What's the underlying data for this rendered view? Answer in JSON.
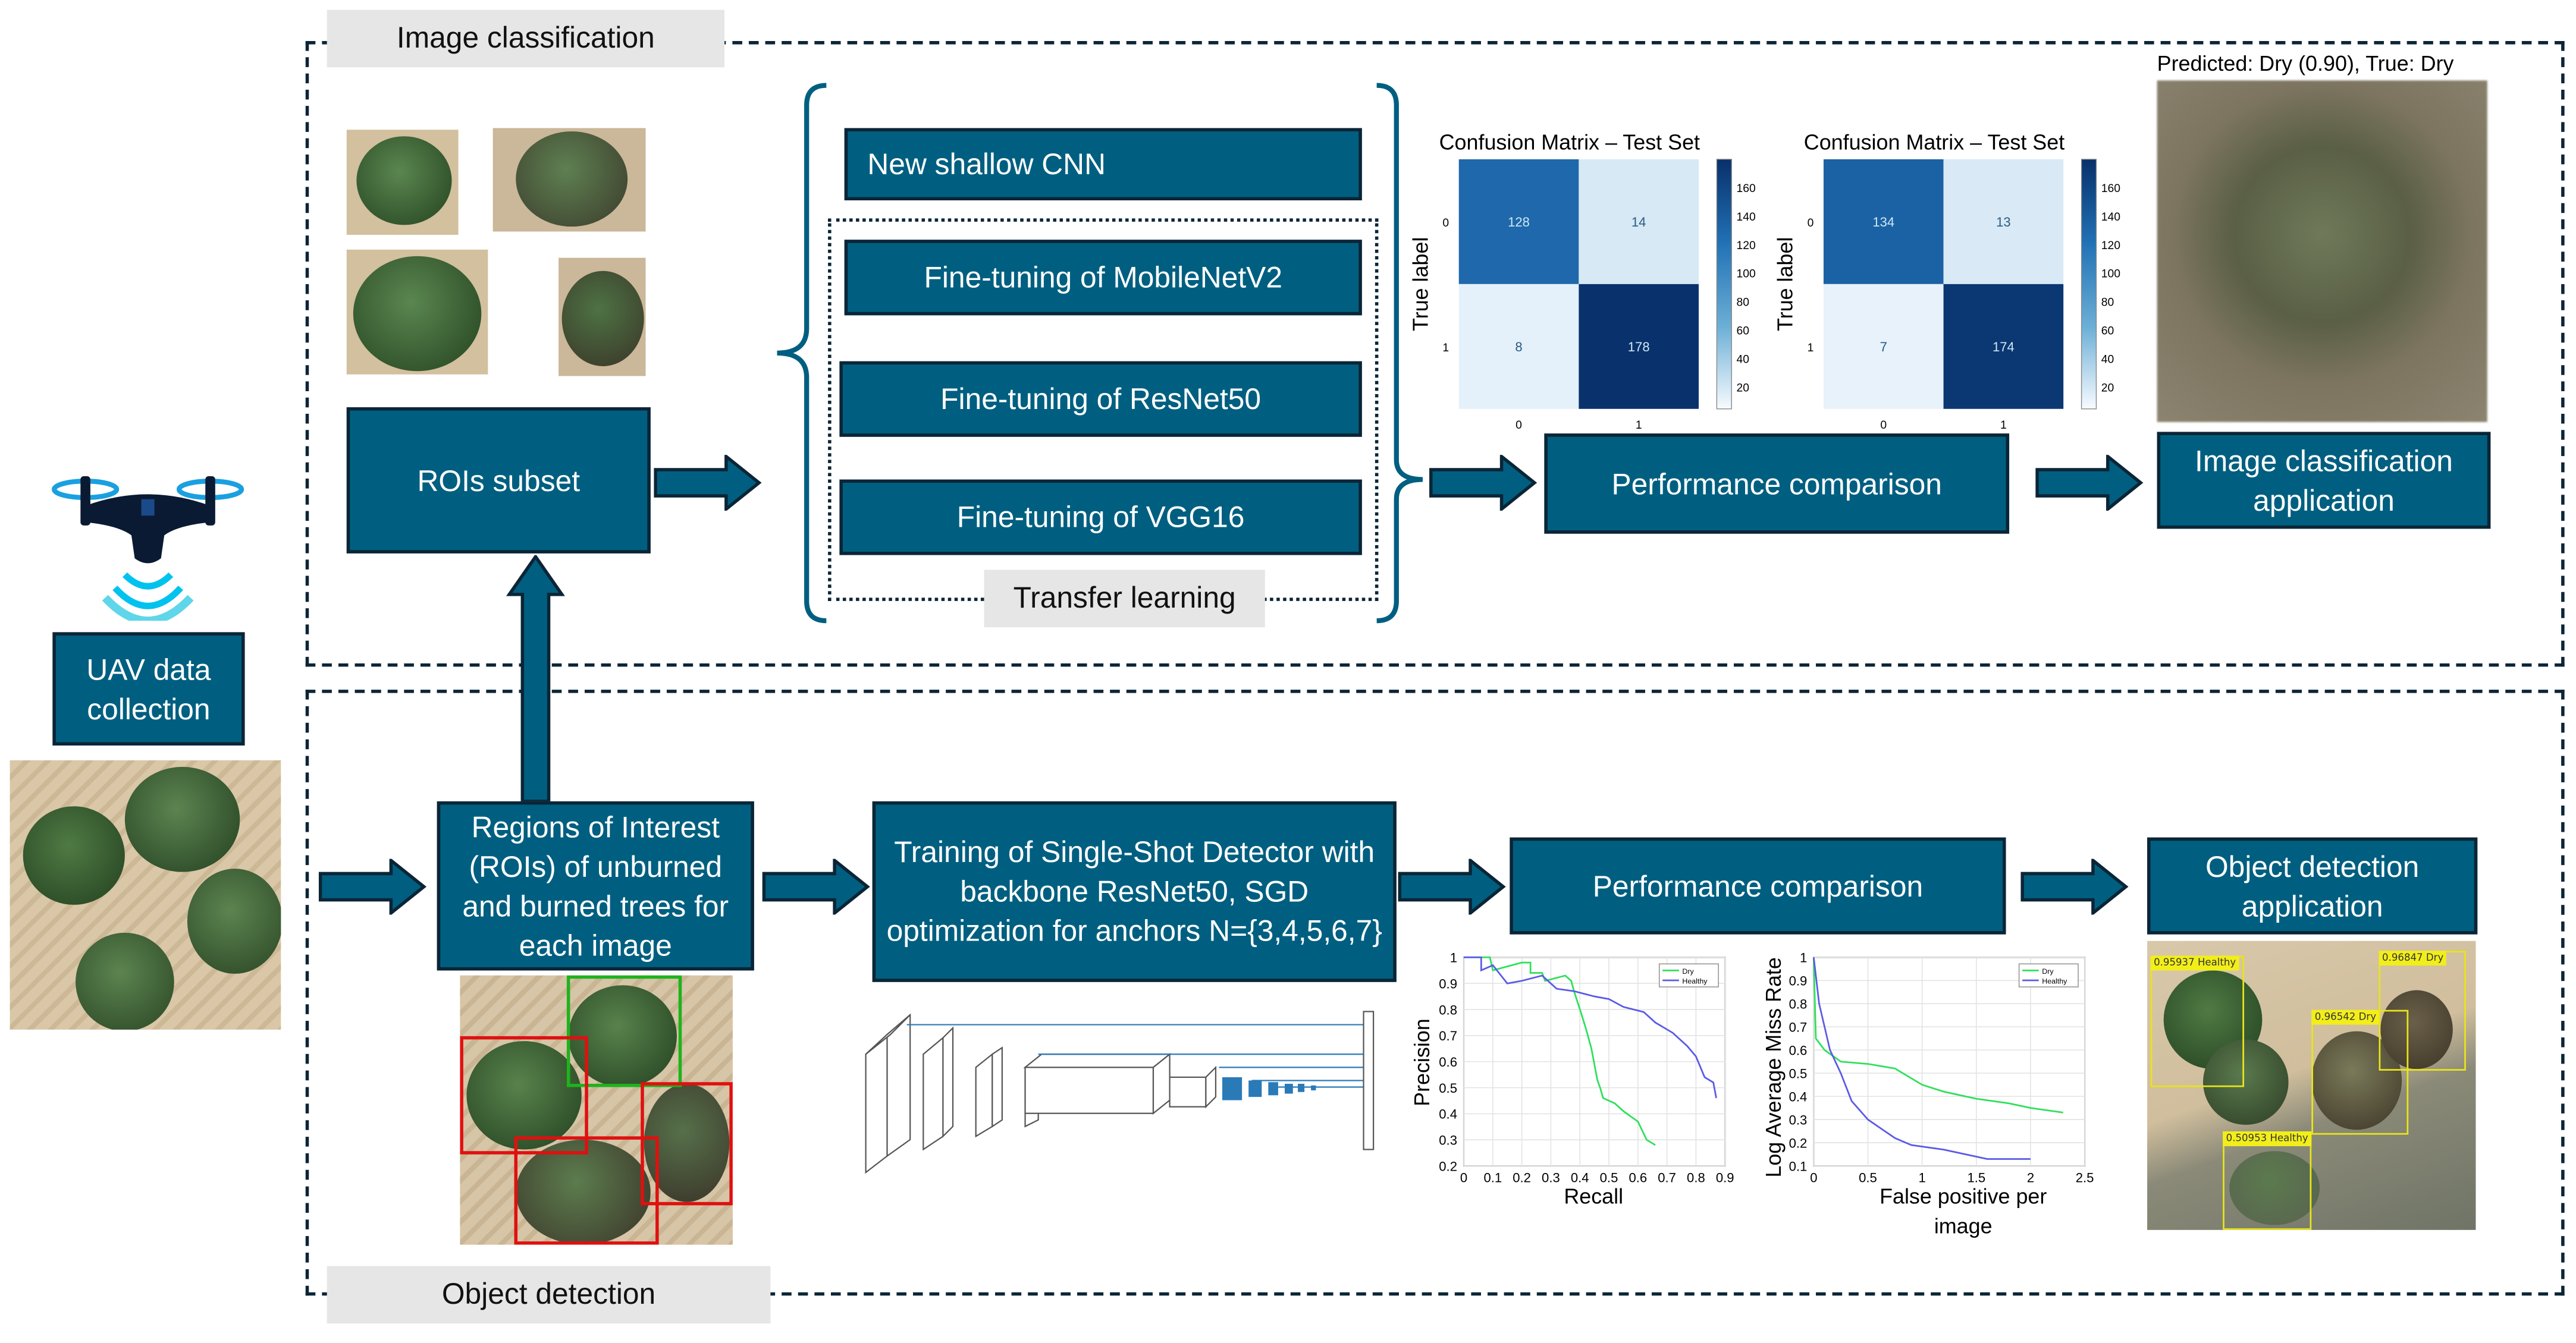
{
  "sections": {
    "classification_label": "Image classification",
    "detection_label": "Object detection"
  },
  "uav": {
    "label": "UAV data collection",
    "icon": "drone-icon"
  },
  "classification": {
    "rois_subset": "ROIs subset",
    "models": {
      "shallow_cnn": "New shallow CNN",
      "mobilenet": "Fine-tuning of MobileNetV2",
      "resnet": "Fine-tuning of ResNet50",
      "vgg": "Fine-tuning of VGG16"
    },
    "transfer_learning": "Transfer learning",
    "performance": "Performance comparison",
    "prediction_caption": "Predicted: Dry (0.90), True: Dry",
    "application": "Image classification application"
  },
  "detection": {
    "rois": "Regions of Interest (ROIs) of unburned and burned trees for each image",
    "training": "Training of Single-Shot Detector with backbone ResNet50, SGD optimization for anchors N={3,4,5,6,7}",
    "performance": "Performance comparison",
    "application": "Object detection application",
    "detections": [
      {
        "score": "0.95937",
        "label": "Healthy"
      },
      {
        "score": "0.96847",
        "label": "Dry"
      },
      {
        "score": "0.96542",
        "label": "Dry"
      },
      {
        "score": "0.50953",
        "label": "Healthy"
      }
    ]
  },
  "colors": {
    "box_fill": "#005f80",
    "box_border": "#0b2536",
    "dry": "#2ee05a",
    "healthy": "#5a5ae6",
    "detection_box": "#f2ee1a",
    "roi_healthy": "#1db31d",
    "roi_burned": "#e01010"
  },
  "chart_data": [
    {
      "type": "heatmap",
      "title": "Confusion Matrix – Test Set",
      "ylabel": "True label",
      "x_ticks": [
        "0",
        "1"
      ],
      "y_ticks": [
        "0",
        "1"
      ],
      "values": [
        [
          128,
          14
        ],
        [
          8,
          178
        ]
      ],
      "colorbar_ticks": [
        "160",
        "140",
        "120",
        "100",
        "80",
        "60",
        "40",
        "20"
      ],
      "colormap": "Blues"
    },
    {
      "type": "heatmap",
      "title": "Confusion Matrix – Test Set",
      "ylabel": "True label",
      "x_ticks": [
        "0",
        "1"
      ],
      "y_ticks": [
        "0",
        "1"
      ],
      "values": [
        [
          134,
          13
        ],
        [
          7,
          174
        ]
      ],
      "colorbar_ticks": [
        "160",
        "140",
        "120",
        "100",
        "80",
        "60",
        "40",
        "20"
      ],
      "colormap": "Blues"
    },
    {
      "type": "line",
      "xlabel": "Recall",
      "ylabel": "Precision",
      "xlim": [
        0,
        0.9
      ],
      "ylim": [
        0.2,
        1
      ],
      "x_ticks": [
        "0",
        "0.1",
        "0.2",
        "0.3",
        "0.4",
        "0.5",
        "0.6",
        "0.7",
        "0.8",
        "0.9"
      ],
      "y_ticks": [
        "0.2",
        "0.3",
        "0.4",
        "0.5",
        "0.6",
        "0.7",
        "0.8",
        "0.9",
        "1"
      ],
      "legend": "top-right",
      "grid": true,
      "series": [
        {
          "name": "Dry",
          "x": [
            0,
            0.09,
            0.1,
            0.2,
            0.23,
            0.23,
            0.27,
            0.28,
            0.35,
            0.37,
            0.38,
            0.4,
            0.42,
            0.44,
            0.46,
            0.47,
            0.48,
            0.52,
            0.55,
            0.6,
            0.63,
            0.66
          ],
          "y": [
            1,
            1,
            0.95,
            0.98,
            0.98,
            0.94,
            0.94,
            0.91,
            0.93,
            0.91,
            0.87,
            0.8,
            0.73,
            0.65,
            0.53,
            0.5,
            0.46,
            0.44,
            0.41,
            0.37,
            0.3,
            0.28
          ]
        },
        {
          "name": "Healthy",
          "x": [
            0,
            0.06,
            0.06,
            0.1,
            0.15,
            0.2,
            0.27,
            0.32,
            0.38,
            0.45,
            0.5,
            0.55,
            0.62,
            0.66,
            0.72,
            0.77,
            0.8,
            0.83,
            0.86,
            0.87
          ],
          "y": [
            1,
            1,
            0.95,
            0.97,
            0.9,
            0.91,
            0.93,
            0.88,
            0.87,
            0.85,
            0.84,
            0.81,
            0.79,
            0.75,
            0.71,
            0.66,
            0.62,
            0.54,
            0.52,
            0.46
          ]
        }
      ]
    },
    {
      "type": "line",
      "xlabel": "False positive per image",
      "ylabel": "Log Average Miss Rate",
      "xlim": [
        0,
        2.5
      ],
      "ylim": [
        0.1,
        1
      ],
      "x_ticks": [
        "0",
        "0.5",
        "1",
        "1.5",
        "2",
        "2.5"
      ],
      "y_ticks": [
        "0.1",
        "0.2",
        "0.3",
        "0.4",
        "0.5",
        "0.6",
        "0.7",
        "0.8",
        "0.9",
        "1"
      ],
      "legend": "top-right",
      "grid": true,
      "series": [
        {
          "name": "Dry",
          "x": [
            0,
            0.02,
            0.1,
            0.25,
            0.5,
            0.75,
            1,
            1.2,
            1.5,
            1.8,
            2,
            2.3
          ],
          "y": [
            1,
            0.65,
            0.6,
            0.55,
            0.54,
            0.52,
            0.45,
            0.42,
            0.39,
            0.37,
            0.35,
            0.33
          ]
        },
        {
          "name": "Healthy",
          "x": [
            0,
            0.05,
            0.15,
            0.25,
            0.35,
            0.5,
            0.75,
            0.9,
            1.2,
            1.6,
            2
          ],
          "y": [
            1,
            0.8,
            0.6,
            0.5,
            0.38,
            0.3,
            0.22,
            0.19,
            0.17,
            0.13,
            0.13
          ]
        }
      ]
    }
  ]
}
